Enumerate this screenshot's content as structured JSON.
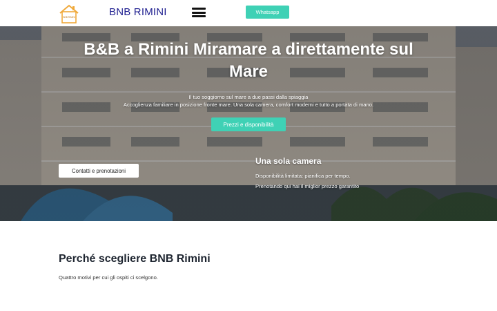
{
  "header": {
    "brand": "BNB RIMINI",
    "logo_text": "BNB RIMINI",
    "whatsapp_label": "Whatsapp",
    "menu_icon": "hamburger-menu-icon",
    "logo_icon": "house-logo-icon",
    "accent_color": "#3fd1b5",
    "brand_color": "#1e1e8f"
  },
  "hero": {
    "title": "B&B a Rimini Miramare a direttamente sul Mare",
    "subtitle_line1": "Il tuo soggiorno sul mare a due passi dalla spiaggia",
    "subtitle_line2": "Accoglienza familiare in posizione fronte mare. Una sola camera, comfort moderni e tutto a portata di mano.",
    "price_button": "Prezzi e disponibilità",
    "contact_button": "Contatti e prenotazioni",
    "room_title": "Una sola camera",
    "room_line1": "Disponibilità limitata: pianifica per tempo.",
    "room_line2": "Prenotando qui hai il miglior prezzo garantito"
  },
  "why": {
    "title": "Perché scegliere BNB Rimini",
    "subtitle": "Quattro motivi per cui gli ospiti ci scelgono."
  }
}
